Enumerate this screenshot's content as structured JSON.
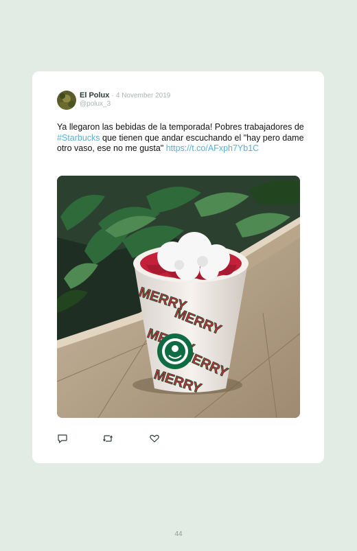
{
  "tweet": {
    "author_name": "El Polux",
    "separator": "·",
    "date": "4 November 2019",
    "handle": "@polux_3",
    "text_1": "Ya llegaron las bebidas de la temporada! Pobres trabajadores de ",
    "hashtag": "#Starbucks",
    "text_2": " que tienen que andar escuchando el \"hay pero dame otro vaso, ese no me gusta\" ",
    "link": "https://t.co/AFxph7Yb1C",
    "photo_icon": "starbucks-holiday-cup-photo",
    "cup_text": "MERRY"
  },
  "actions": {
    "reply_icon": "speech-bubble-icon",
    "retweet_icon": "retweet-arrows-icon",
    "like_icon": "heart-icon"
  },
  "page": {
    "number": "44"
  },
  "colors": {
    "background": "#e3ebe5",
    "card": "#ffffff",
    "link": "#5aaed4",
    "muted": "#a9b4ae"
  }
}
